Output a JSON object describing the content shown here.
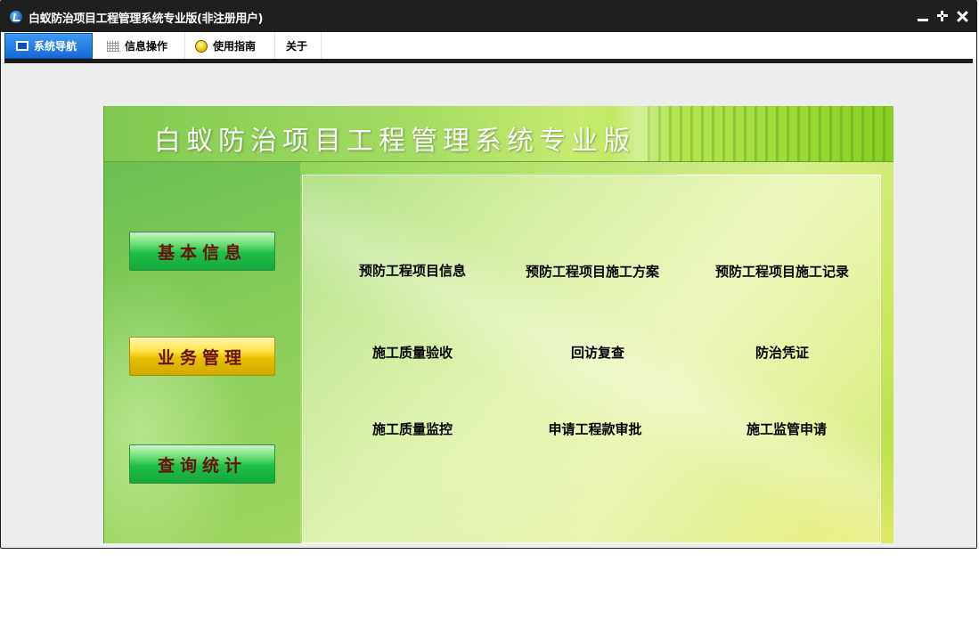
{
  "window": {
    "title": "白蚁防治项目工程管理系统专业版(非注册用户)",
    "icons": {
      "app": "app-logo-icon",
      "minimize": "minimize-icon",
      "restore": "restore-icon",
      "close": "close-icon"
    }
  },
  "tabs": [
    {
      "label": "系统导航",
      "icon": "monitor-icon",
      "active": true
    },
    {
      "label": "信息操作",
      "icon": "grid-icon",
      "active": false
    },
    {
      "label": "使用指南",
      "icon": "lightbulb-icon",
      "active": false
    },
    {
      "label": "关于",
      "icon": "",
      "active": false
    }
  ],
  "panel": {
    "title": "白蚁防治项目工程管理系统专业版",
    "nav_buttons": [
      {
        "label": "基本信息",
        "color": "#1fbf45",
        "selected": false
      },
      {
        "label": "业务管理",
        "color": "#e6c100",
        "selected": true
      },
      {
        "label": "查询统计",
        "color": "#1fbf45",
        "selected": false
      }
    ],
    "features": [
      [
        "预防工程项目信息",
        "预防工程项目施工方案",
        "预防工程项目施工记录"
      ],
      [
        "施工质量验收",
        "回访复查",
        "防治凭证"
      ],
      [
        "施工质量监控",
        "申请工程款审批",
        "施工监管申请"
      ]
    ]
  },
  "colors": {
    "titlebar": "#1f1f1f",
    "active_tab": "#1668d8",
    "button_text": "#6b0f0f"
  }
}
